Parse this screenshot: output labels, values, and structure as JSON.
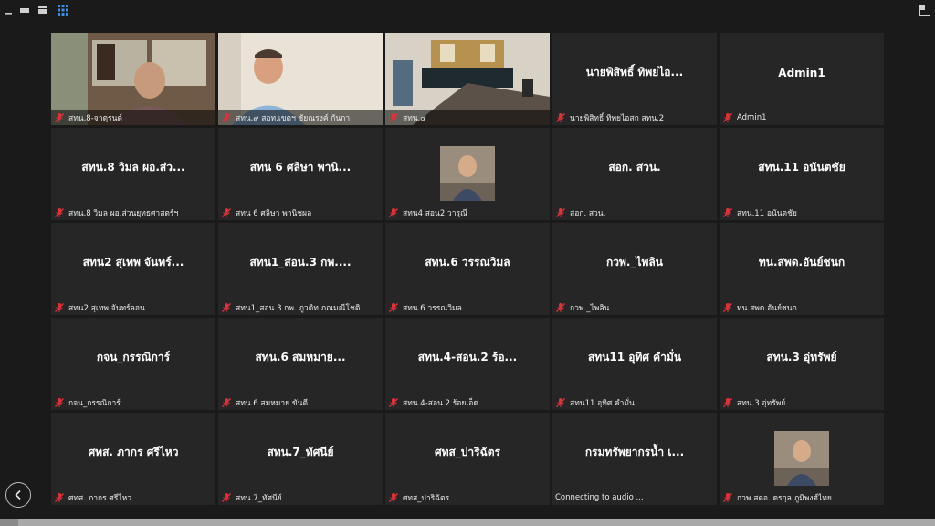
{
  "window": {
    "icons": [
      "minimize-icon",
      "speaker-view-icon",
      "stacked-view-icon",
      "gallery-view-icon",
      "exit-fullscreen-icon"
    ]
  },
  "tiles": [
    {
      "name": "",
      "label": "สทน.8-จาตุรนต์",
      "video": true
    },
    {
      "name": "",
      "label": "สทน.๙ สอท.เขตฯ ชัยณรงค์ กันกา",
      "video": true
    },
    {
      "name": "",
      "label": "สทน.๔",
      "video": true
    },
    {
      "name": "นายพิสิทธิ์ ทิพยไอ...",
      "label": "นายพิสิทธิ์ ทิพยไอสถ สทน.2",
      "video": false
    },
    {
      "name": "Admin1",
      "label": "Admin1",
      "video": false
    },
    {
      "name": "สทน.8 วิมล ผอ.ส่ว...",
      "label": "สทน.8 วิมล ผอ.ส่วนยุทธศาสตร์ฯ",
      "video": false
    },
    {
      "name": "สทน 6 ศลิษา พานิ...",
      "label": "สทน 6 ศลิษา พานิชผล",
      "video": false
    },
    {
      "name": "",
      "label": "สทน4 สอน2 วารุณี",
      "video": false,
      "avatar": true
    },
    {
      "name": "สอก. สวน.",
      "label": "สอก. สวน.",
      "video": false
    },
    {
      "name": "สทน.11 อนันตชัย",
      "label": "สทน.11 อนันตชัย",
      "video": false
    },
    {
      "name": "สทน2 สุเทพ จันทร์...",
      "label": "สทน2 สุเทพ จันทร์ลอน",
      "video": false
    },
    {
      "name": "สทน1_สอน.3 กพ....",
      "label": "สทน1_สอน.3 กพ. ภูวดิท ภณมณีโชติ",
      "video": false
    },
    {
      "name": "สทน.6 วรรณวิมล",
      "label": "สทน.6 วรรณวิมล",
      "video": false
    },
    {
      "name": "กวพ._ไพลิน",
      "label": "กวพ._ไพลิน",
      "video": false
    },
    {
      "name": "ทน.สพด.อันย์ชนก",
      "label": "ทน.สพด.อันย์ชนก",
      "video": false
    },
    {
      "name": "กจน_กรรณิการ์",
      "label": "กจน_กรรณิการ์",
      "video": false
    },
    {
      "name": "สทน.6 สมหมาย...",
      "label": "สทน.6 สมหมาย ขันตี",
      "video": false
    },
    {
      "name": "สทน.4-สอน.2 ร้อ...",
      "label": "สทน.4-สอน.2 ร้อยเอ็ด",
      "video": false
    },
    {
      "name": "สทน11 อุทิศ คำมั่น",
      "label": "สทน11 อุทิศ คำมั่น",
      "video": false
    },
    {
      "name": "สทน.3 อุ่ทรัพย์",
      "label": "สทน.3 อุ่ทรัพย์",
      "video": false
    },
    {
      "name": "ศทส. ภากร ศรีไหว",
      "label": "ศทส. ภากร ศรีไหว",
      "video": false
    },
    {
      "name": "สทน.7_ทัศนีย์",
      "label": "สทน.7_ทัศนีย์",
      "video": false
    },
    {
      "name": "ศทส_ปาริฉัตร",
      "label": "ศทส_ปาริฉัตร",
      "video": false
    },
    {
      "name": "กรมทรัพยากรน้ำ เ...",
      "label": "Connecting to audio ...",
      "video": false,
      "connecting": true
    },
    {
      "name": "",
      "label": "กวพ.สตอ. ดรกุล ภูมิพงศ์ไทย",
      "video": false,
      "avatar": true
    }
  ],
  "colors": {
    "tile_bg": "#262626",
    "page_bg": "#1a1a1a",
    "mic_muted": "#e0303a"
  }
}
